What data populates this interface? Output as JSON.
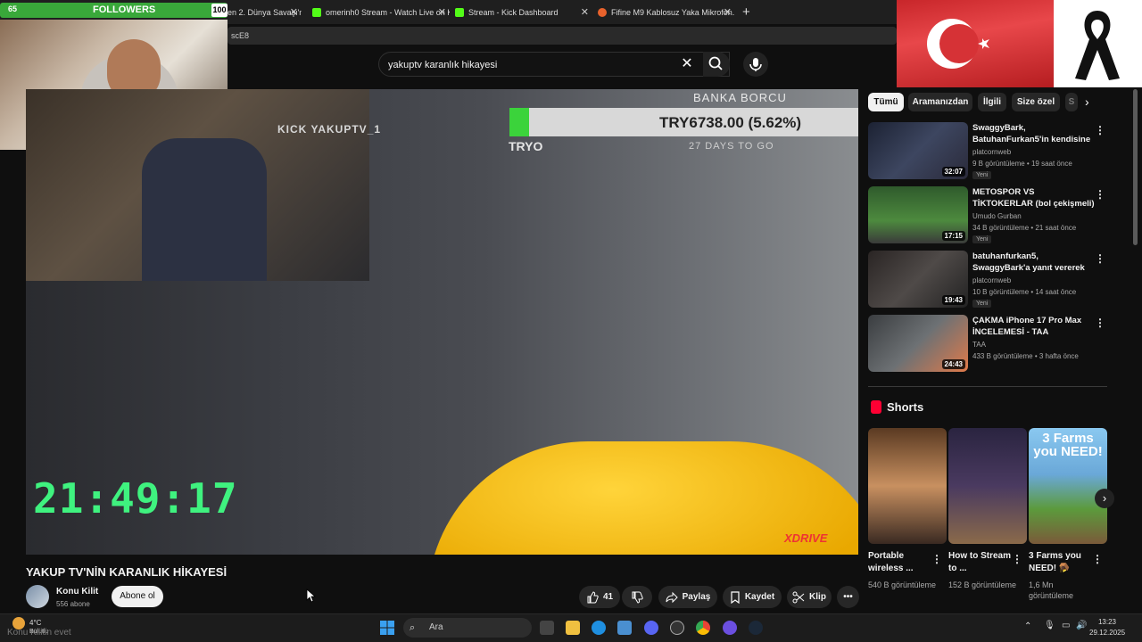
{
  "overlay": {
    "followers_label": "FOLLOWERS",
    "followers_count": "65",
    "followers_goal": "100"
  },
  "browser": {
    "tabs": [
      {
        "title": "Bu Ada Neden 2. Dünya Savaşı'nı E..."
      },
      {
        "title": "omerinh0 Stream - Watch Live on Kic..."
      },
      {
        "title": "Stream - Kick Dashboard"
      },
      {
        "title": "Fifine M9 Kablosuz Yaka Mikrofon..."
      }
    ],
    "address_fragment": "scE8"
  },
  "search": {
    "query": "yakuptv karanlık hikayesi"
  },
  "video_overlay": {
    "kick_label": "KICK YAKUPTV_1",
    "debt_label": "BANKA BORCU",
    "debt_value": "TRY6738.00 (5.62%)",
    "debt_progress": 0.0562,
    "debt_currency": "TRYO",
    "days_left": "27 DAYS TO GO",
    "clock": "21:49:17",
    "watermark": "XDRIVE"
  },
  "video": {
    "title": "YAKUP TV'NİN KARANLIK HİKAYESİ",
    "channel": "Konu Kilit",
    "subscribers": "556 abone",
    "subscribe_label": "Abone ol",
    "likes": "41",
    "share_label": "Paylaş",
    "save_label": "Kaydet",
    "clip_label": "Klip"
  },
  "sidebar": {
    "chips": [
      "Tümü",
      "Aramanızdan",
      "İlgili",
      "Size özel",
      "S"
    ],
    "recommendations": [
      {
        "title": "SwaggyBark, BatuhanFurkan5'in kendisine küfür etmesi ...",
        "channel": "platcornweb",
        "meta": "9 B görüntüleme • 19 saat önce",
        "badge": "Yeni",
        "duration": "32:07"
      },
      {
        "title": "METOSPOR VS TİKTOKERLAR (bol çekişmeli)",
        "channel": "Umudo Gurban",
        "meta": "34 B görüntüleme • 21 saat önce",
        "badge": "Yeni",
        "duration": "17:15"
      },
      {
        "title": "batuhanfurkan5, SwaggyBark'a yanıt vererek kendisi hakkında...",
        "channel": "platcornweb",
        "meta": "10 B görüntüleme • 14 saat önce",
        "badge": "Yeni",
        "duration": "19:43"
      },
      {
        "title": "ÇAKMA iPhone 17 Pro Max İNCELEMESİ - TAA",
        "channel": "TAA",
        "meta": "433 B görüntüleme • 3 hafta önce",
        "badge": "",
        "duration": "24:43"
      }
    ],
    "shorts_title": "Shorts",
    "shorts": [
      {
        "title": "Portable wireless ...",
        "views": "540 B görüntüleme"
      },
      {
        "title": "How to Stream to ...",
        "views": "152 B görüntüleme"
      },
      {
        "title": "3 Farms you NEED! 🪤",
        "views": "1,6 Mn görüntüleme",
        "thumb_text": "3 Farms you NEED!"
      }
    ]
  },
  "taskbar": {
    "search_label": "Ara",
    "temp": "4°C",
    "weather": "Bulutlu",
    "time": "13:23",
    "date": "29.12.2025",
    "chat_overlay": "Konu Kilitin evet"
  },
  "colors": {
    "accent": "#39a83a",
    "youtube_red": "#ff0033",
    "bg": "#0f0f0f"
  }
}
